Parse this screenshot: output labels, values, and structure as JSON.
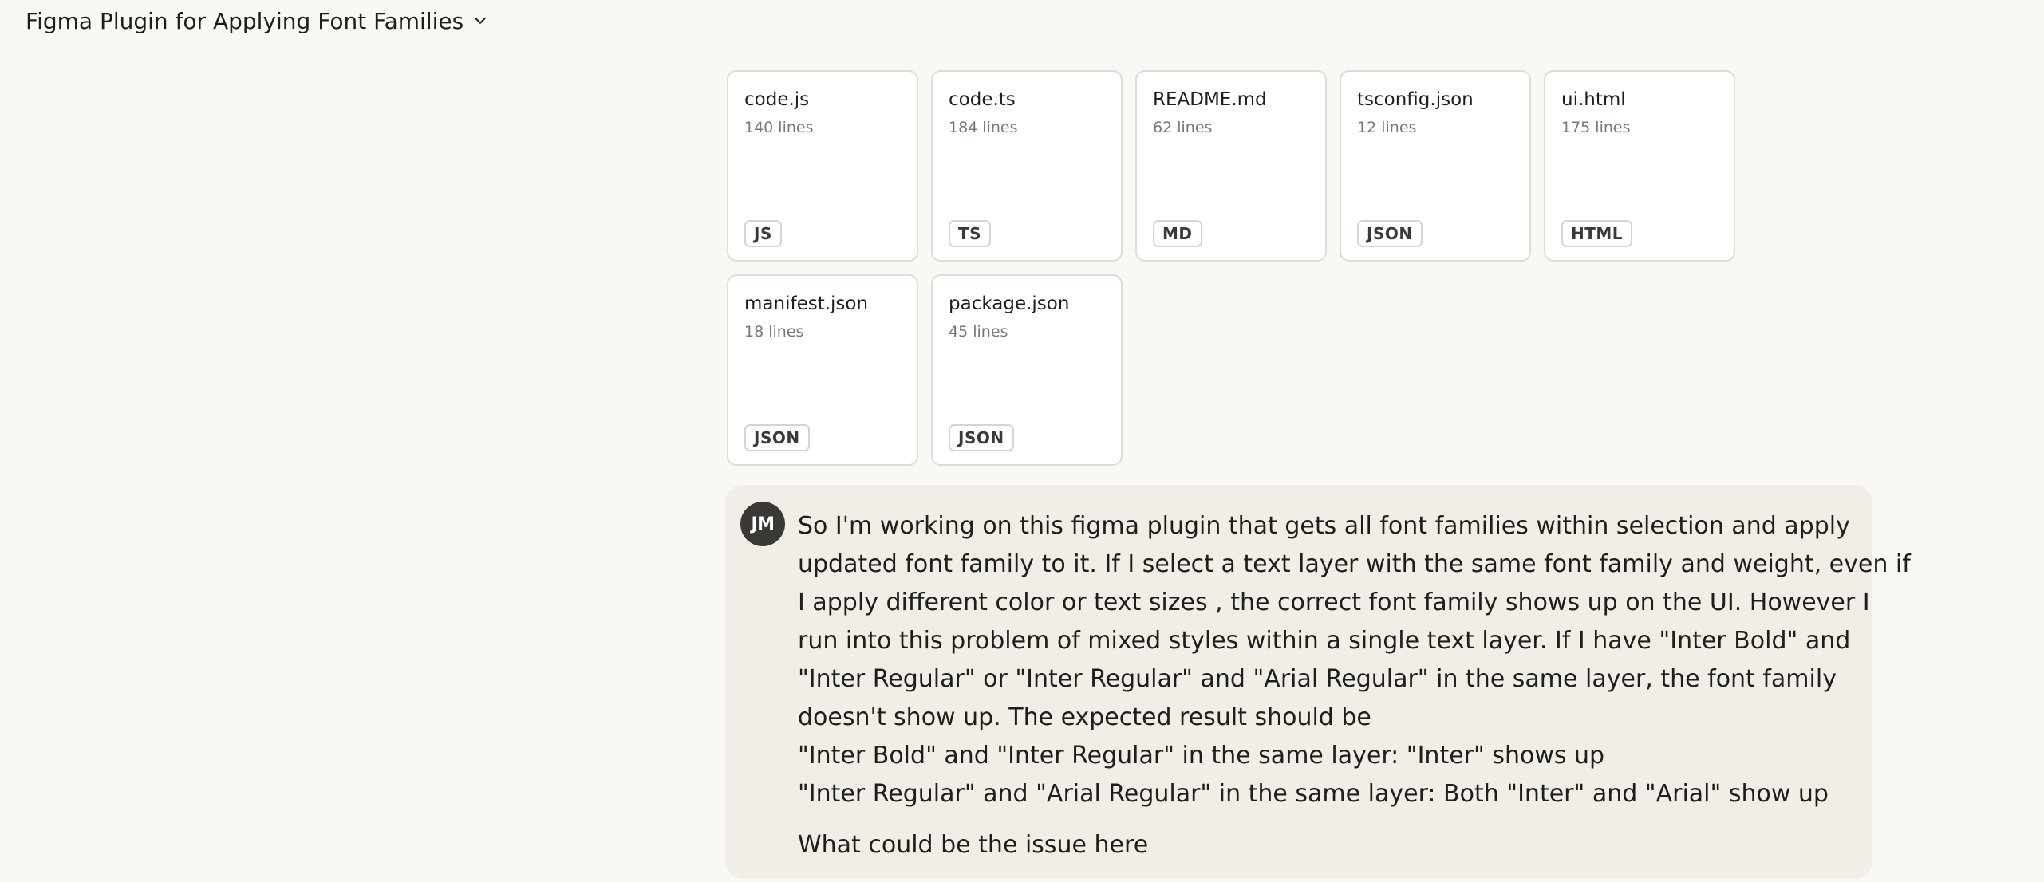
{
  "header": {
    "title": "Figma Plugin for Applying Font Families",
    "dropdown_icon": "chevron-down-icon"
  },
  "files": [
    {
      "name": "code.js",
      "lines": "140 lines",
      "badge": "JS"
    },
    {
      "name": "code.ts",
      "lines": "184 lines",
      "badge": "TS"
    },
    {
      "name": "README.md",
      "lines": "62 lines",
      "badge": "MD"
    },
    {
      "name": "tsconfig.json",
      "lines": "12 lines",
      "badge": "JSON"
    },
    {
      "name": "ui.html",
      "lines": "175 lines",
      "badge": "HTML"
    },
    {
      "name": "manifest.json",
      "lines": "18 lines",
      "badge": "JSON"
    },
    {
      "name": "package.json",
      "lines": "45 lines",
      "badge": "JSON"
    }
  ],
  "message": {
    "avatar_initials": "JM",
    "lines": [
      "So I'm working on this figma plugin that gets all font families within selection and apply",
      "updated font family to it. If I select a text layer with the same font family and weight, even if",
      "I apply different color or text sizes , the correct font family shows up on the UI. However I",
      "run into this problem of mixed styles within a single text layer. If I have \"Inter Bold\" and",
      "\"Inter Regular\" or \"Inter Regular\" and \"Arial Regular\" in the same layer, the font family",
      "doesn't show up. The expected result should be",
      "\"Inter Bold\" and \"Inter Regular\" in the same layer: \"Inter\" shows up",
      "\"Inter Regular\" and \"Arial Regular\" in the same layer: Both \"Inter\" and \"Arial\" show up"
    ],
    "question": "What could be the issue here"
  }
}
